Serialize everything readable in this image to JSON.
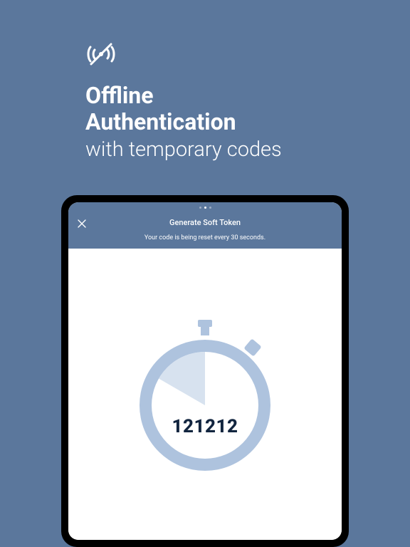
{
  "hero": {
    "title_line1": "Offline",
    "title_line2": "Authentication",
    "subtitle": "with temporary codes"
  },
  "app": {
    "title": "Generate Soft Token",
    "subtitle": "Your code is being reset every 30 seconds.",
    "code": "121212"
  },
  "colors": {
    "bg": "#5b779c",
    "light": "#aec3de",
    "dark": "#12253f"
  }
}
